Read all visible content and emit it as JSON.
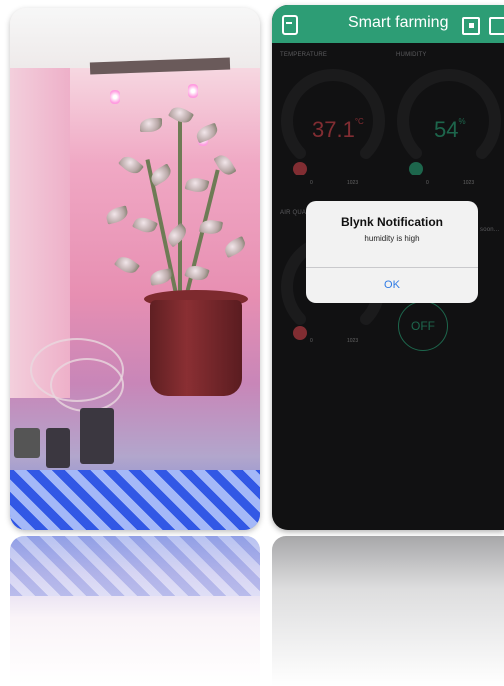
{
  "app": {
    "title": "Smart farming",
    "accent_color": "#2d9d75",
    "icons": [
      "back-icon",
      "device-icon",
      "square-icon"
    ]
  },
  "widgets": {
    "temperature": {
      "label": "TEMPERATURE",
      "value": "37.1",
      "unit": "°C",
      "min": "0",
      "max": "1023",
      "color": "#c7454d"
    },
    "humidity": {
      "label": "HUMIDITY",
      "value": "54",
      "unit": "%",
      "min": "0",
      "max": "1023",
      "color": "#2d9d75"
    },
    "air_quality": {
      "label": "AIR QUALI",
      "min": "0",
      "max": "1023",
      "color": "#c7454d"
    },
    "partial_label": "soon...",
    "button": {
      "label": "OFF"
    }
  },
  "notification": {
    "title": "Blynk Notification",
    "message": "humidity is high",
    "ok_label": "OK",
    "ok_color": "#2f7be5"
  }
}
